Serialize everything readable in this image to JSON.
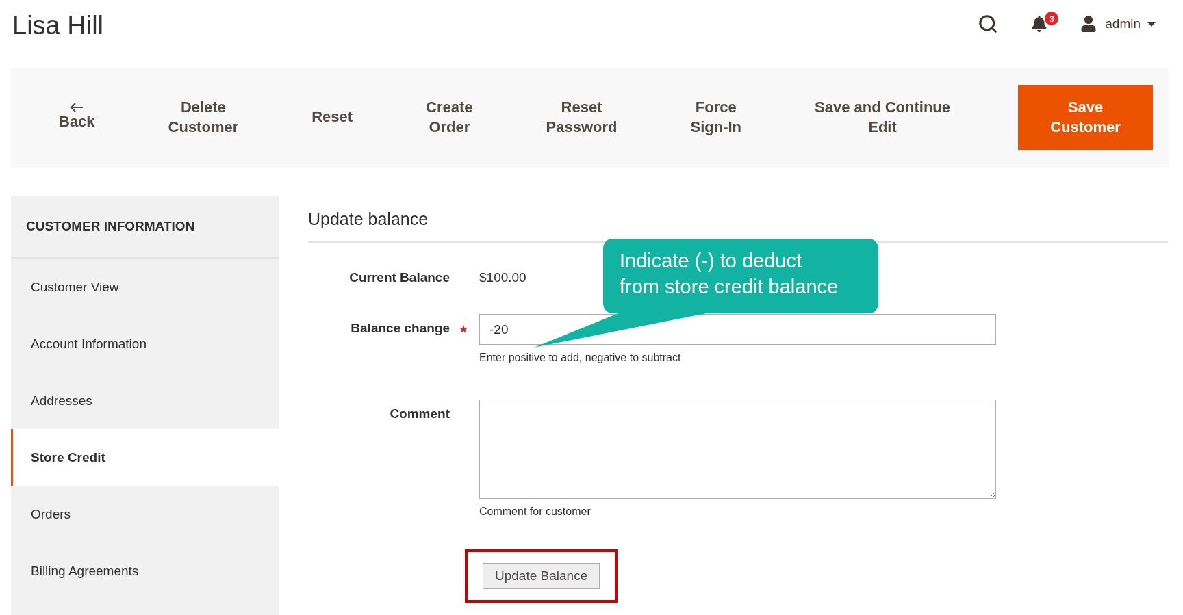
{
  "header": {
    "title": "Lisa Hill",
    "notifications": "3",
    "user": "admin"
  },
  "toolbar": {
    "buttons": [
      {
        "label": "Back",
        "kind": "back"
      },
      {
        "label": "Delete\nCustomer",
        "kind": "plain"
      },
      {
        "label": "Reset",
        "kind": "plain"
      },
      {
        "label": "Create\nOrder",
        "kind": "plain"
      },
      {
        "label": "Reset\nPassword",
        "kind": "plain"
      },
      {
        "label": "Force\nSign-In",
        "kind": "plain"
      },
      {
        "label": "Save and Continue\nEdit",
        "kind": "plain"
      },
      {
        "label": "Save\nCustomer",
        "kind": "primary"
      }
    ]
  },
  "sidebar": {
    "heading": "CUSTOMER INFORMATION",
    "items": [
      {
        "label": "Customer View",
        "selected": false
      },
      {
        "label": "Account Information",
        "selected": false
      },
      {
        "label": "Addresses",
        "selected": false
      },
      {
        "label": "Store Credit",
        "selected": true
      },
      {
        "label": "Orders",
        "selected": false
      },
      {
        "label": "Billing Agreements",
        "selected": false
      }
    ]
  },
  "form": {
    "title": "Update balance",
    "fields": [
      {
        "kind": "static",
        "label": "Current Balance",
        "value": "$100.00"
      },
      {
        "kind": "input",
        "label": "Balance change",
        "required": true,
        "value": "-20",
        "hint": "Enter positive to add, negative to subtract"
      },
      {
        "kind": "textarea",
        "label": "Comment",
        "hint": "Comment for customer"
      }
    ],
    "button": {
      "label": "Update Balance",
      "highlighted": true
    }
  },
  "callout": {
    "text": "Indicate (-) to deduct\nfrom store credit balance"
  }
}
